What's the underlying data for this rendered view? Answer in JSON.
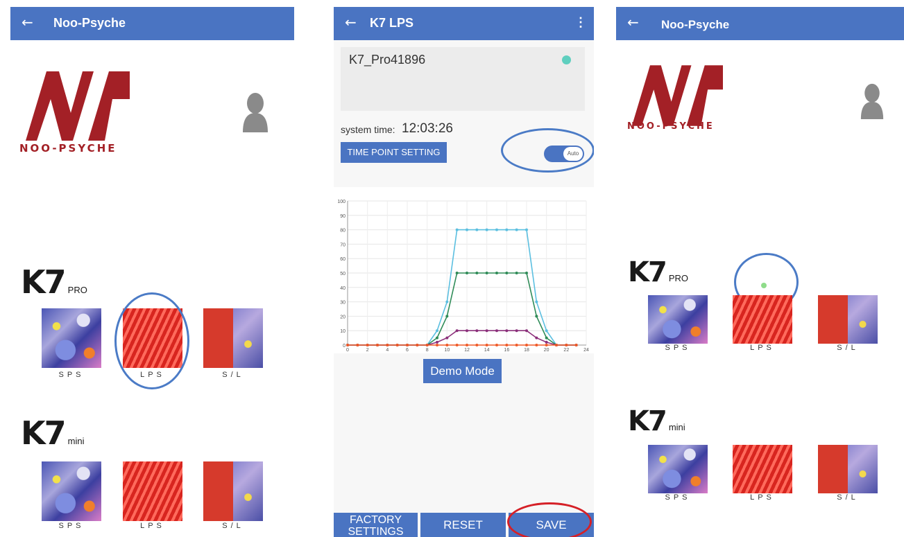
{
  "screens": [
    {
      "app_title": "Noo-Psyche",
      "logo_text": "NOO-PSYCHE",
      "groups": [
        {
          "model": "K7",
          "variant": "PRO",
          "items": [
            "SPS",
            "LPS",
            "S/L"
          ]
        },
        {
          "model": "K7",
          "variant": "mini",
          "items": [
            "SPS",
            "LPS",
            "S/L"
          ]
        }
      ]
    },
    {
      "app_title": "K7 LPS",
      "device_name": "K7_Pro41896",
      "system_time_label": "system time:",
      "system_time": "12:03:26",
      "time_point_button": "TIME POINT SETTING",
      "toggle_label": "Auto",
      "demo_button": "Demo Mode",
      "bottom_buttons": [
        "FACTORY SETTINGS",
        "RESET",
        "SAVE"
      ]
    },
    {
      "app_title": "Noo-Psyche",
      "logo_text": "NOO-PSYCHE",
      "groups": [
        {
          "model": "K7",
          "variant": "PRO",
          "items": [
            "SPS",
            "LPS",
            "S/L"
          ]
        },
        {
          "model": "K7",
          "variant": "mini",
          "items": [
            "SPS",
            "LPS",
            "S/L"
          ]
        }
      ]
    }
  ],
  "colors": {
    "appbar": "#4a74c2",
    "logo_red": "#a32026",
    "annotation_blue": "#4b7bc6",
    "annotation_red": "#d52027",
    "status_dot": "#5fcfbf"
  },
  "chart_data": {
    "type": "line",
    "x": [
      0,
      1,
      2,
      3,
      4,
      5,
      6,
      7,
      8,
      9,
      10,
      11,
      12,
      13,
      14,
      15,
      16,
      17,
      18,
      19,
      20,
      21,
      22,
      23
    ],
    "xticks": [
      0,
      2,
      4,
      6,
      8,
      10,
      12,
      14,
      16,
      18,
      20,
      22,
      24
    ],
    "yticks": [
      0,
      10,
      20,
      30,
      40,
      50,
      60,
      70,
      80,
      90,
      100
    ],
    "xlim": [
      0,
      24
    ],
    "ylim": [
      0,
      100
    ],
    "grid": true,
    "series": [
      {
        "color": "#5bbfe0",
        "values": [
          0,
          0,
          0,
          0,
          0,
          0,
          0,
          0,
          0,
          10,
          30,
          80,
          80,
          80,
          80,
          80,
          80,
          80,
          80,
          30,
          10,
          0,
          0,
          0
        ]
      },
      {
        "color": "#2e8b57",
        "values": [
          0,
          0,
          0,
          0,
          0,
          0,
          0,
          0,
          0,
          5,
          20,
          50,
          50,
          50,
          50,
          50,
          50,
          50,
          50,
          20,
          5,
          0,
          0,
          0
        ]
      },
      {
        "color": "#8b2f7a",
        "values": [
          0,
          0,
          0,
          0,
          0,
          0,
          0,
          0,
          0,
          2,
          5,
          10,
          10,
          10,
          10,
          10,
          10,
          10,
          10,
          5,
          2,
          0,
          0,
          0
        ]
      },
      {
        "color": "#f05a28",
        "values": [
          0,
          0,
          0,
          0,
          0,
          0,
          0,
          0,
          0,
          0,
          0,
          0,
          0,
          0,
          0,
          0,
          0,
          0,
          0,
          0,
          0,
          0,
          0,
          0
        ]
      }
    ]
  }
}
